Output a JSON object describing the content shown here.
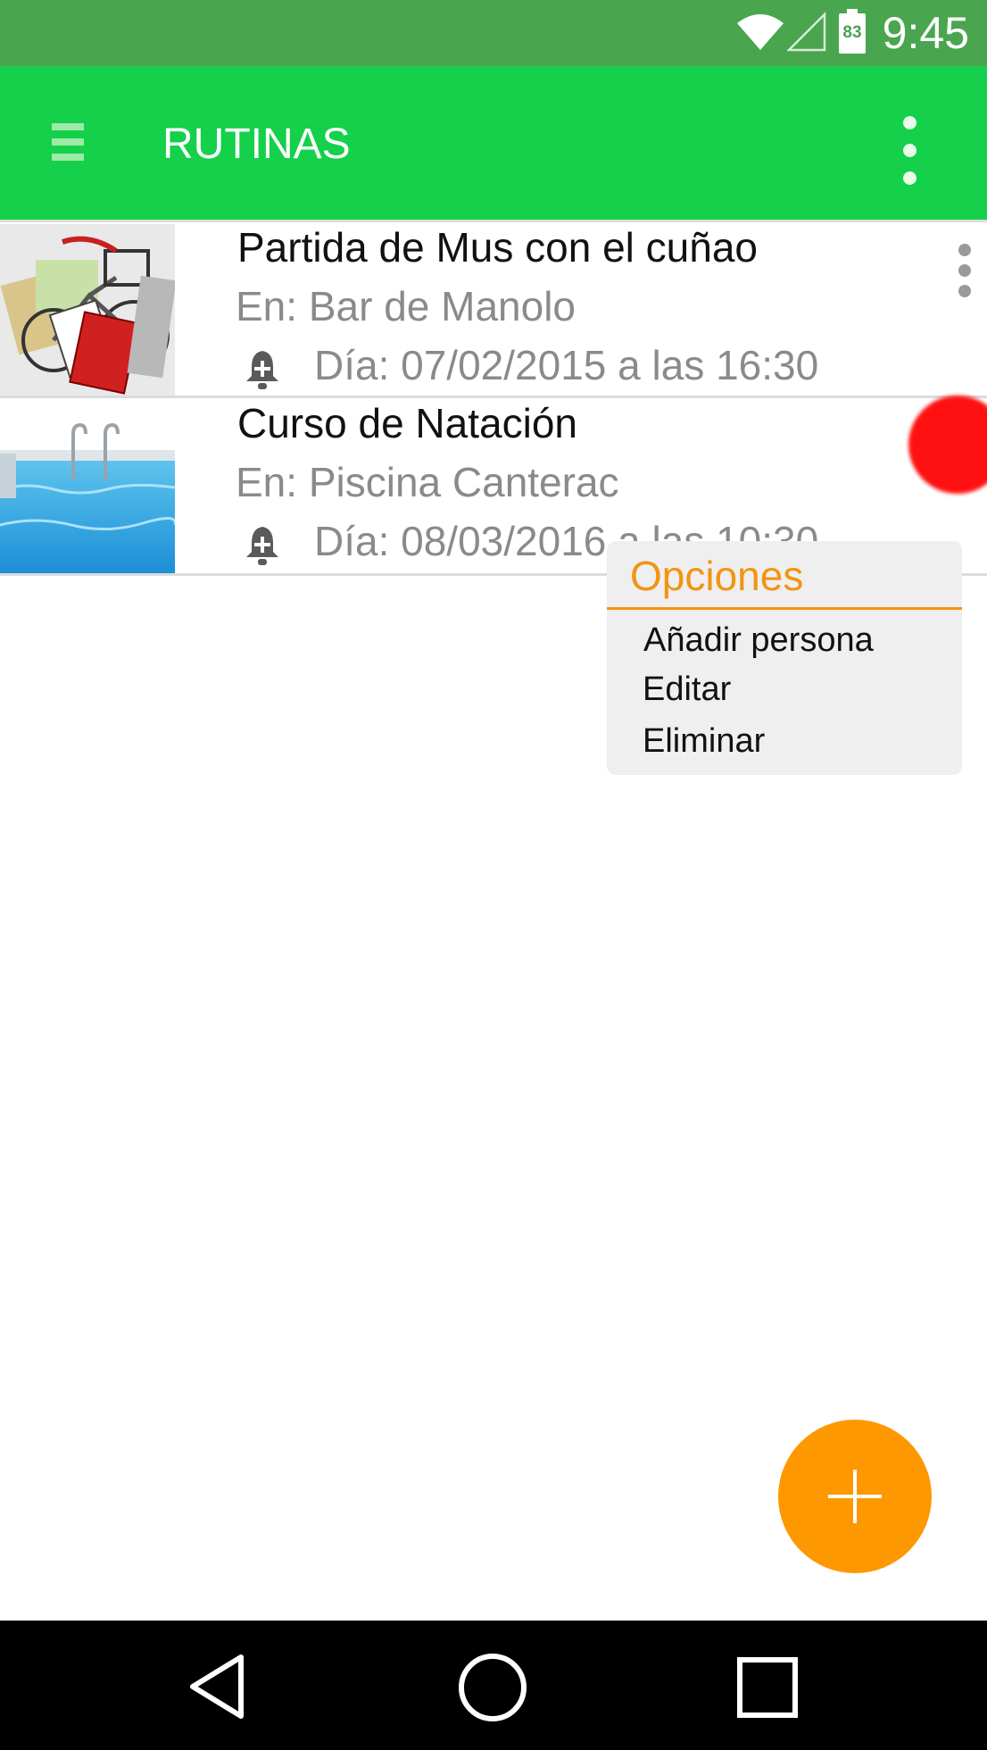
{
  "status_bar": {
    "time": "9:45",
    "battery_level": "83"
  },
  "app_bar": {
    "title": "RUTINAS"
  },
  "routines": [
    {
      "title": "Partida de Mus con el cuñao",
      "place": "En: Bar de Manolo",
      "date": "Día: 07/02/2015 a las 16:30"
    },
    {
      "title": "Curso de Natación",
      "place": "En: Piscina Canterac",
      "date": "Día: 08/03/2016 a las 10:30"
    }
  ],
  "options_menu": {
    "title": "Opciones",
    "items": [
      "Añadir persona",
      "Editar",
      "Eliminar"
    ]
  },
  "colors": {
    "status_bar": "#4aa54f",
    "app_bar": "#14d04a",
    "accent": "#f39412",
    "fab": "#fd9800",
    "touch_indicator": "#ff1111"
  },
  "icons": [
    "menu-icon",
    "overflow-icon",
    "bell-plus-icon",
    "plus-icon",
    "back-icon",
    "home-icon",
    "recents-icon",
    "wifi-icon",
    "signal-icon",
    "battery-icon"
  ]
}
